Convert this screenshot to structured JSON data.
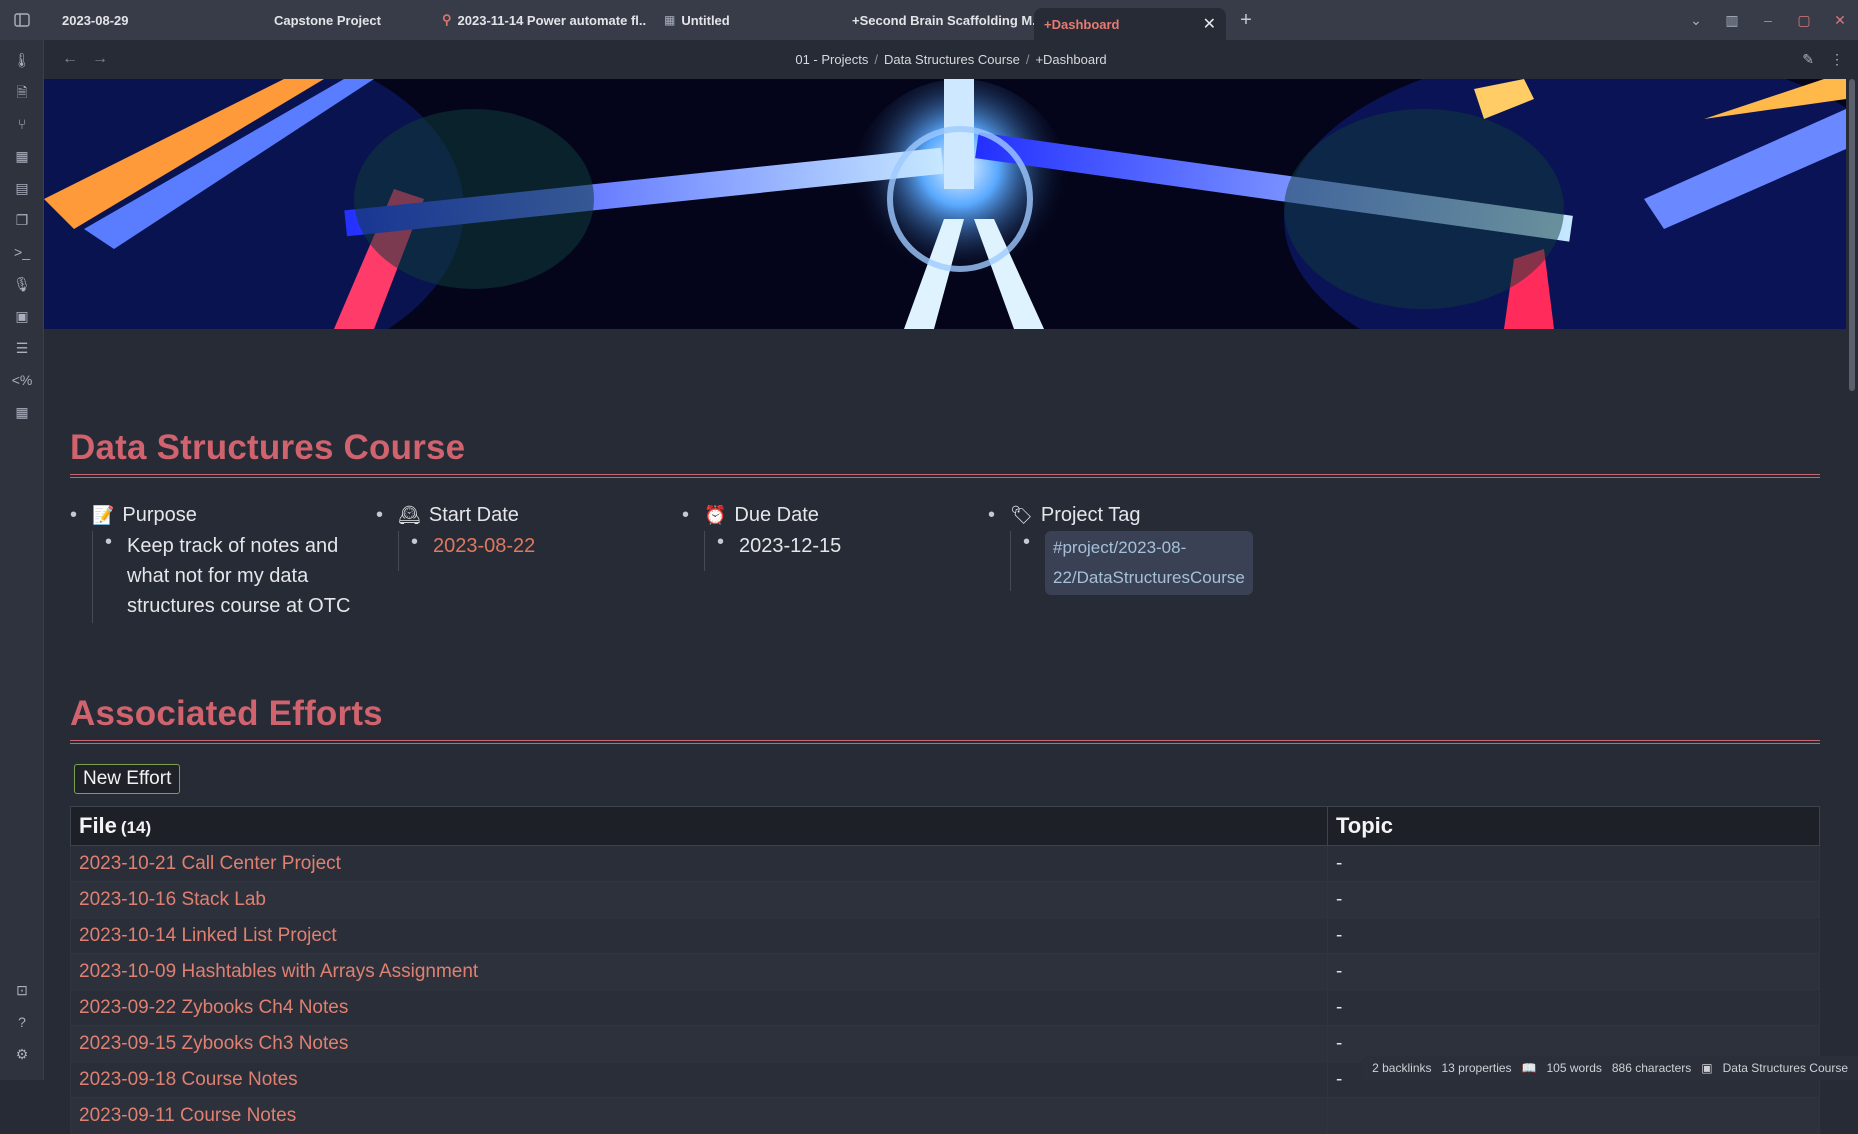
{
  "tabs": [
    {
      "label": "2023-08-29",
      "icon": ""
    },
    {
      "label": "Capstone Project",
      "icon": ""
    },
    {
      "label": "2023-11-14 Power automate fl...",
      "icon": "pin-icon"
    },
    {
      "label": "Untitled",
      "icon": "grid-icon"
    },
    {
      "label": "+Second Brain Scaffolding M...",
      "icon": ""
    },
    {
      "label": "+Dashboard",
      "icon": "",
      "active": true
    }
  ],
  "breadcrumb": [
    "01 - Projects",
    "Data Structures Course",
    "+Dashboard"
  ],
  "page": {
    "title": "Data Structures Course",
    "meta": {
      "purpose_label": "Purpose",
      "purpose_value": "Keep track of notes and what not for my data structures course at OTC",
      "start_label": "Start Date",
      "start_value": "2023-08-22",
      "due_label": "Due Date",
      "due_value": "2023-12-15",
      "tag_label": "Project Tag",
      "tag_value": "#project/2023-08-22/DataStructuresCourse"
    },
    "efforts_title": "Associated Efforts",
    "new_effort_button": "New Effort",
    "table": {
      "col_file": "File",
      "file_count": "(14)",
      "col_topic": "Topic",
      "rows": [
        {
          "file": "2023-10-21 Call Center Project",
          "topic": "-"
        },
        {
          "file": "2023-10-16 Stack Lab",
          "topic": "-"
        },
        {
          "file": "2023-10-14 Linked List Project",
          "topic": "-"
        },
        {
          "file": "2023-10-09 Hashtables with Arrays Assignment",
          "topic": "-"
        },
        {
          "file": "2023-09-22 Zybooks Ch4 Notes",
          "topic": "-"
        },
        {
          "file": "2023-09-15 Zybooks Ch3 Notes",
          "topic": "-"
        },
        {
          "file": "2023-09-18 Course Notes",
          "topic": "-"
        },
        {
          "file": "2023-09-11 Course Notes",
          "topic": ""
        }
      ]
    }
  },
  "status": {
    "backlinks": "2 backlinks",
    "properties": "13 properties",
    "words": "105 words",
    "characters": "886 characters",
    "note": "Data Structures Course"
  },
  "colors": {
    "heading": "#d0636d",
    "link": "#e08070",
    "accent_tab": "#e87a72"
  }
}
